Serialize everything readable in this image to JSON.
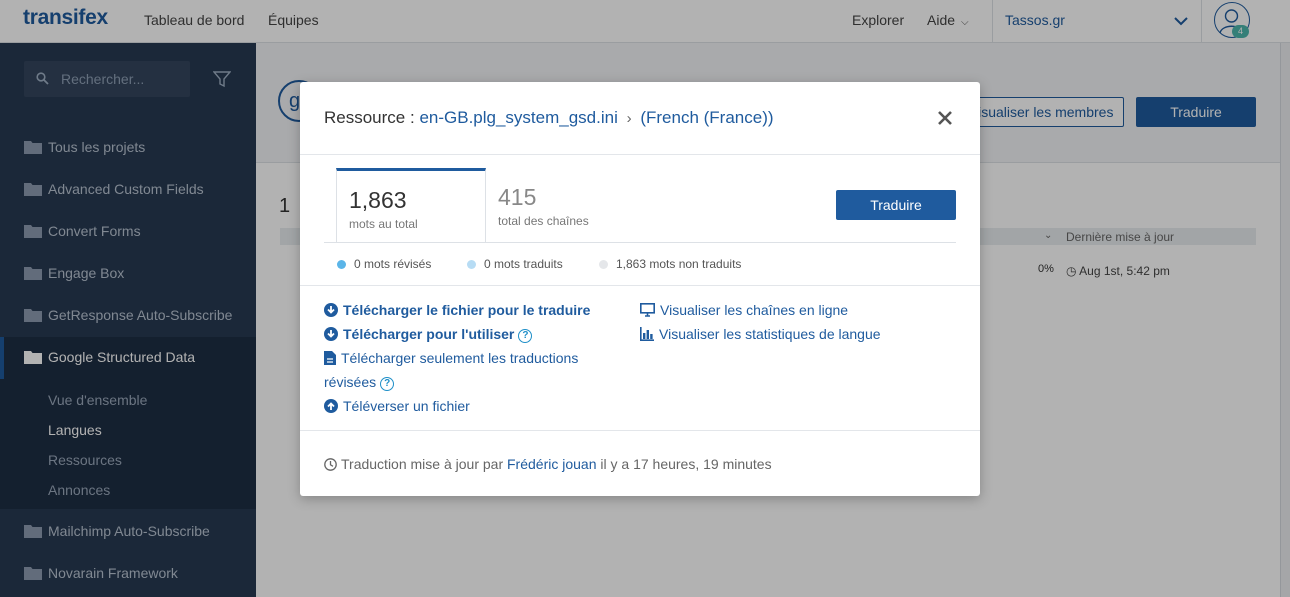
{
  "topbar": {
    "logo": "transifex",
    "nav": [
      "Tableau de bord",
      "Équipes"
    ],
    "explore": "Explorer",
    "help": "Aide",
    "org": "Tassos.gr",
    "notification_count": "4"
  },
  "sidebar": {
    "search_placeholder": "Rechercher...",
    "projects": [
      "Tous les projets",
      "Advanced Custom Fields",
      "Convert Forms",
      "Engage Box",
      "GetResponse Auto-Subscribe",
      "Google Structured Data",
      "Mailchimp Auto-Subscribe",
      "Novarain Framework"
    ],
    "active_project": "Google Structured Data",
    "sub_items": [
      "Vue d'ensemble",
      "Langues",
      "Ressources",
      "Annonces"
    ],
    "active_sub": "Langues"
  },
  "background": {
    "avatar_letter": "g",
    "members_button": "Visualiser les membres",
    "translate_button": "Traduire",
    "count": "1",
    "last_update_col": "Dernière mise à jour",
    "pct": "0%",
    "date": "Aug 1st, 5:42 pm"
  },
  "modal": {
    "title_prefix": "Ressource :",
    "resource": "en-GB.plg_system_gsd.ini",
    "language": "(French (France))",
    "stats": {
      "words_total": "1,863",
      "words_total_label": "mots au total",
      "strings_total": "415",
      "strings_total_label": "total des chaînes"
    },
    "translate_button": "Traduire",
    "legend": [
      {
        "text": "0 mots révisés",
        "color": "#5bb5e8"
      },
      {
        "text": "0 mots traduits",
        "color": "#b7dcf4"
      },
      {
        "text": "1,863 mots non traduits",
        "color": "#e5e7ea"
      }
    ],
    "actions_left": {
      "download_translate": "Télécharger le fichier pour le traduire",
      "download_use": "Télécharger pour l'utiliser",
      "download_reviewed_line1": "Télécharger seulement les traductions",
      "download_reviewed_line2": "révisées",
      "upload": "Téléverser un fichier"
    },
    "actions_right": {
      "view_online": "Visualiser les chaînes en ligne",
      "view_stats": "Visualiser les statistiques de langue"
    },
    "footer": {
      "prefix": "Traduction mise à jour par",
      "user": "Frédéric jouan",
      "suffix": "il y a 17 heures, 19 minutes"
    },
    "accent_color": "#1f5b9e"
  }
}
